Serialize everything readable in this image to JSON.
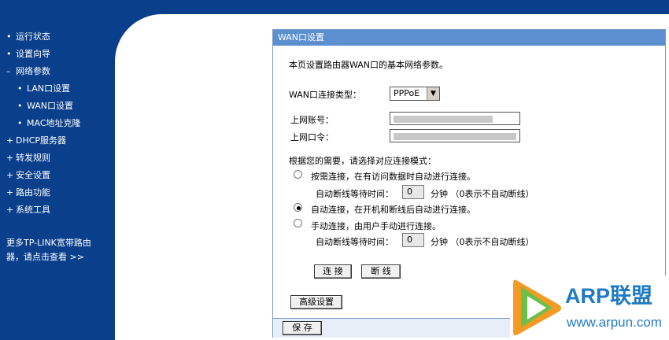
{
  "sidebar": {
    "items": [
      {
        "bullet": "•",
        "label": "运行状态",
        "sub": false
      },
      {
        "bullet": "•",
        "label": "设置向导",
        "sub": false
      },
      {
        "bullet": "–",
        "label": "网络参数",
        "sub": false
      },
      {
        "bullet": "•",
        "label": "LAN口设置",
        "sub": true
      },
      {
        "bullet": "•",
        "label": "WAN口设置",
        "sub": true
      },
      {
        "bullet": "•",
        "label": "MAC地址克隆",
        "sub": true
      },
      {
        "bullet": "+",
        "label": "DHCP服务器",
        "sub": false
      },
      {
        "bullet": "+",
        "label": "转发规则",
        "sub": false
      },
      {
        "bullet": "+",
        "label": "安全设置",
        "sub": false
      },
      {
        "bullet": "+",
        "label": "路由功能",
        "sub": false
      },
      {
        "bullet": "+",
        "label": "系统工具",
        "sub": false
      }
    ],
    "more_line1": "更多TP-LINK宽带路由",
    "more_line2": "器，请点击查看 >>"
  },
  "panel": {
    "title": "WAN口设置",
    "description": "本页设置路由器WAN口的基本网络参数。",
    "conn_type_label": "WAN口连接类型：",
    "conn_type_value": "PPPoE",
    "account_label": "上网账号：",
    "password_label": "上网口令：",
    "mode_prompt": "根据您的需要，请选择对应连接模式：",
    "mode_on_demand": "按需连接，在有访问数据时自动进行连接。",
    "idle_label_1": "自动断线等待时间：",
    "idle_value_1": "0",
    "idle_unit_1": "分钟 （0表示不自动断线）",
    "mode_auto": "自动连接，在开机和断线后自动进行连接。",
    "mode_manual": "手动连接，由用户手动进行连接。",
    "idle_label_2": "自动断线等待时间：",
    "idle_value_2": "0",
    "idle_unit_2": "分钟 （0表示不自动断线）",
    "connect_btn": "连 接",
    "disconnect_btn": "断 线",
    "advanced_btn": "高级设置",
    "save_btn": "保 存"
  },
  "watermark": {
    "title": "ARP联盟",
    "url": "www.arpun.com"
  },
  "colors": {
    "nav_blue": "#0a3f8c",
    "title_bar": "#5b8fd0",
    "logo_blue": "#1f7ac4"
  }
}
